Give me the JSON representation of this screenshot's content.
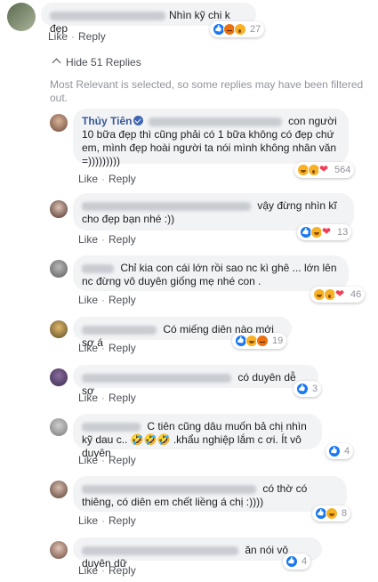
{
  "top_comment": {
    "text": "Nhìn kỹ chi k đẹp",
    "reaction_count": "27",
    "reactions": [
      "like",
      "angry",
      "wow"
    ],
    "like_label": "Like",
    "reply_label": "Reply"
  },
  "hide_replies_label": "Hide 51 Replies",
  "filter_note": "Most Relevant is selected, so some replies may have been filtered out.",
  "replies": [
    {
      "author": "Thủy Tiên",
      "text": "con người 10 bữa đẹp thì cũng phải có 1 bữa không có đẹp chứ em, mình đẹp hoài người ta nói mình không nhân văn =)))))))))",
      "reactions": [
        "haha",
        "wow",
        "love"
      ],
      "reaction_count": "564",
      "like_label": "Like",
      "reply_label": "Reply"
    },
    {
      "text": "vậy đừng nhìn kĩ cho đẹp bạn nhé :))",
      "reactions": [
        "like",
        "haha",
        "love"
      ],
      "reaction_count": "13",
      "like_label": "Like",
      "reply_label": "Reply"
    },
    {
      "text": "Chỉ kia con cái lớn rồi sao nc kì ghê ... lớn lên nc đừng vô duyên giống mẹ nhé con .",
      "reactions": [
        "haha",
        "wow",
        "love"
      ],
      "reaction_count": "46",
      "like_label": "Like",
      "reply_label": "Reply"
    },
    {
      "text": "Có miếng diên nào mới sợ á",
      "reactions": [
        "like",
        "haha",
        "angry"
      ],
      "reaction_count": "19",
      "like_label": "Like",
      "reply_label": "Reply"
    },
    {
      "text": "có duyên dễ sợ",
      "reactions": [
        "like"
      ],
      "reaction_count": "3",
      "like_label": "Like",
      "reply_label": "Reply"
    },
    {
      "text": "C tiên cũng dâu muốn bả chị nhìn kỹ dau c.. 🤣🤣🤣 .khẩu nghiệp lắm c ơi. Ít vô duyên",
      "reactions": [
        "like"
      ],
      "reaction_count": "4",
      "like_label": "Like",
      "reply_label": "Reply"
    },
    {
      "text": "có thờ có thiêng, có diên em chết liềng á chị :))))",
      "reactions": [
        "like",
        "haha"
      ],
      "reaction_count": "8",
      "like_label": "Like",
      "reply_label": "Reply"
    },
    {
      "text": "ăn nói vô duyên dữ",
      "reactions": [
        "like"
      ],
      "reaction_count": "4",
      "like_label": "Like",
      "reply_label": "Reply"
    }
  ]
}
